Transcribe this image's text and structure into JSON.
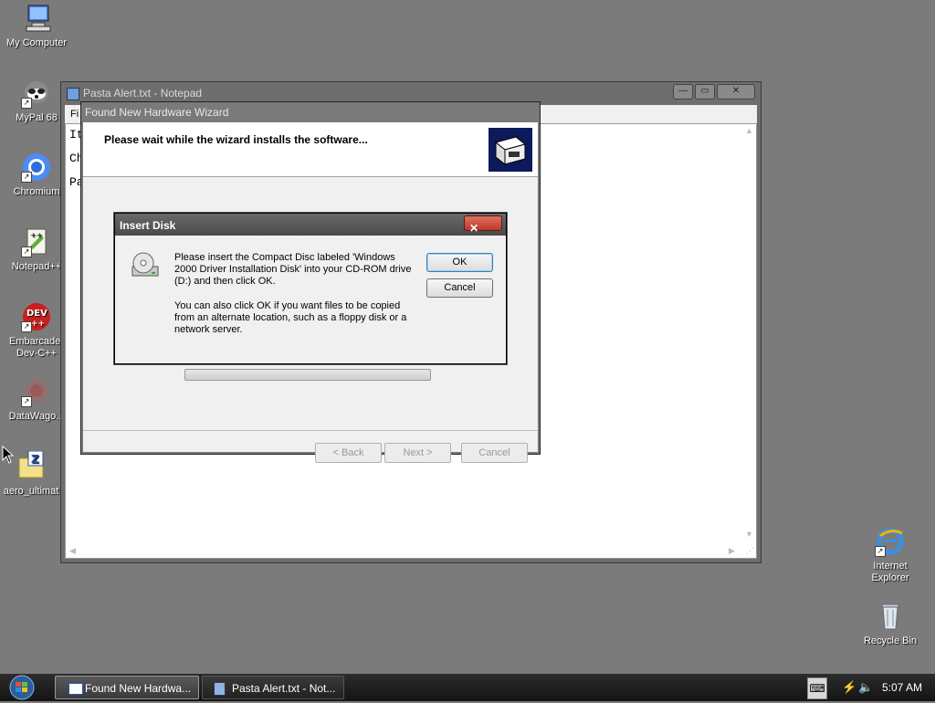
{
  "desktop": {
    "icons": [
      {
        "label": "My Computer",
        "icon": "computer-icon"
      },
      {
        "label": "MyPal 68",
        "icon": "mypal-icon"
      },
      {
        "label": "Chromium",
        "icon": "chromium-icon"
      },
      {
        "label": "Notepad++",
        "icon": "notepadpp-icon"
      },
      {
        "label": "Embarcader Dev-C++",
        "icon": "devcpp-icon"
      },
      {
        "label": "DataWago...",
        "icon": "datawagon-icon"
      },
      {
        "label": "aero_ultimat",
        "icon": "zip-folder-icon"
      },
      {
        "label": "Internet Explorer",
        "icon": "ie-icon"
      },
      {
        "label": "Recycle Bin",
        "icon": "recycle-bin-icon"
      }
    ]
  },
  "notepad": {
    "title": "Pasta Alert.txt - Notepad",
    "menu_first": "Fi",
    "lines": [
      "It",
      "Ch",
      "Pa"
    ]
  },
  "wizard": {
    "title": "Found New Hardware Wizard",
    "header_text": "Please wait while the wizard installs the software...",
    "back_label": "< Back",
    "next_label": "Next >",
    "cancel_label": "Cancel",
    "progress": 0.0
  },
  "insert_disk": {
    "title": "Insert Disk",
    "message1": "Please insert the Compact Disc labeled 'Windows 2000 Driver Installation Disk' into your CD-ROM drive (D:) and then click OK.",
    "message2": "You can also click OK if you want files to be copied from an alternate location, such as a floppy disk or a network server.",
    "ok_label": "OK",
    "cancel_label": "Cancel",
    "close_glyph": "✕"
  },
  "taskbar": {
    "tasks": [
      {
        "label": "Found New Hardwa...",
        "active": true
      },
      {
        "label": "Pasta Alert.txt - Not...",
        "active": false
      }
    ],
    "clock": "5:07 AM"
  },
  "colors": {
    "desktop": "#7b7b7b",
    "taskbar": "#1e1e1e",
    "dialog_bg": "#f0f0f0",
    "close_button": "#c9473c"
  }
}
